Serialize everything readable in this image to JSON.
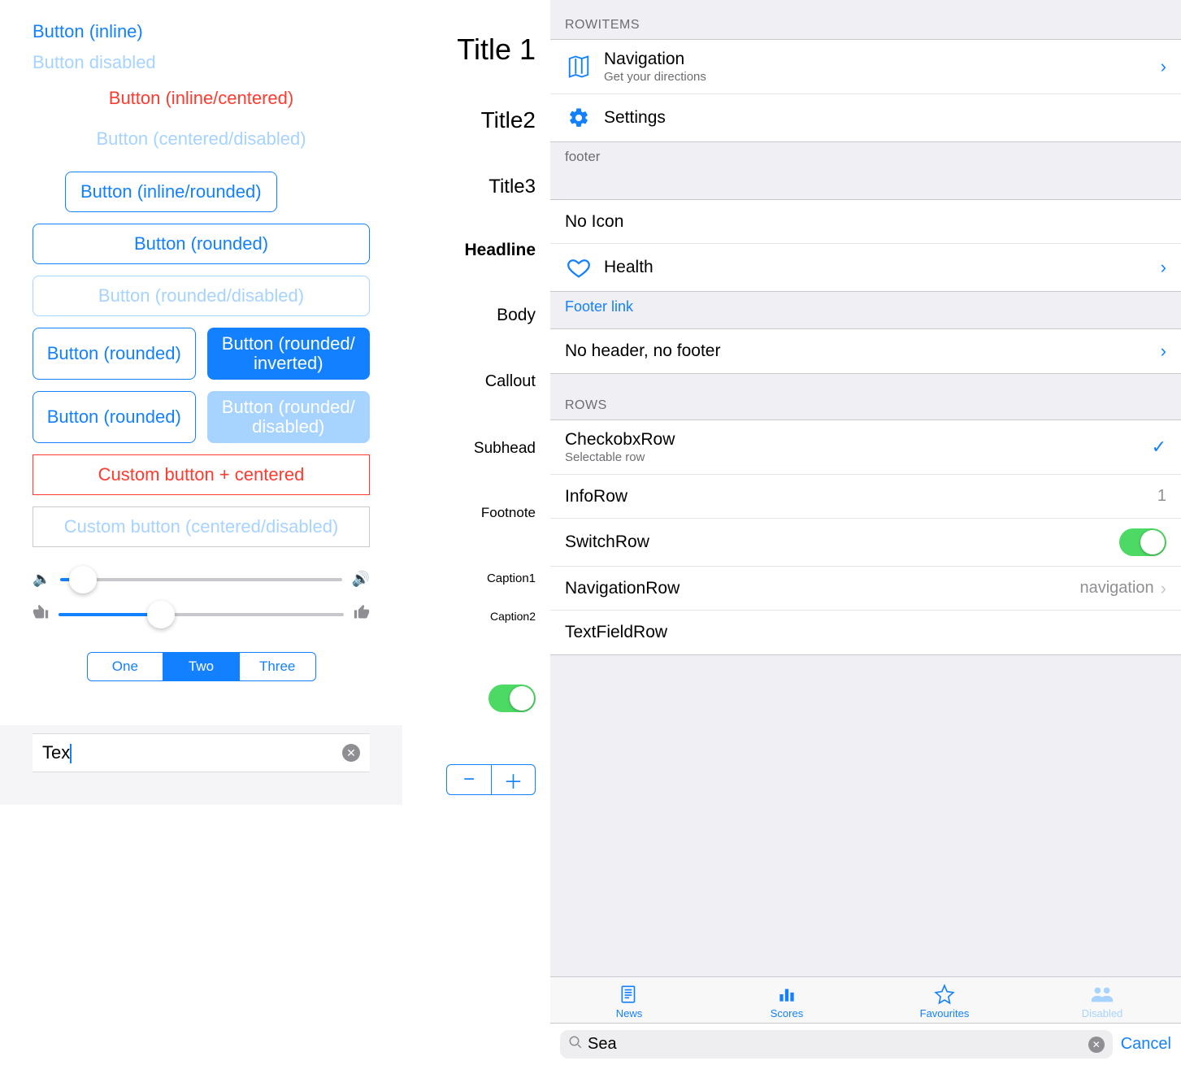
{
  "leftPanel": {
    "buttons": {
      "inline": "Button (inline)",
      "disabled": "Button disabled",
      "inlineCentered": "Button (inline/centered)",
      "centeredDisabled": "Button (centered/disabled)",
      "inlineRounded": "Button (inline/rounded)",
      "rounded": "Button (rounded)",
      "roundedDisabled": "Button (rounded/disabled)",
      "rounded2": "Button (rounded)",
      "roundedInverted": "Button (rounded/\ninverted)",
      "rounded3": "Button (rounded)",
      "roundedInvDisabled": "Button (rounded/\ndisabled)",
      "customCentered": "Custom button + centered",
      "customDisabled": "Custom button (centered/disabled)"
    },
    "sliders": {
      "volume": {
        "value": 8,
        "min": 0,
        "max": 100,
        "leftIcon": "volume-low",
        "rightIcon": "volume-high"
      },
      "like": {
        "value": 36,
        "min": 0,
        "max": 100,
        "leftIcon": "thumbs-down",
        "rightIcon": "thumbs-up"
      }
    },
    "segmented": {
      "options": [
        "One",
        "Two",
        "Three"
      ],
      "selectedIndex": 1
    },
    "textfield": {
      "value": "Tex"
    }
  },
  "typography": {
    "title1": "Title 1",
    "title2": "Title2",
    "title3": "Title3",
    "headline": "Headline",
    "body": "Body",
    "callout": "Callout",
    "subhead": "Subhead",
    "footnote": "Footnote",
    "caption1": "Caption1",
    "caption2": "Caption2"
  },
  "midControls": {
    "switchOn": true
  },
  "rightPanel": {
    "sections": {
      "rowItemsHeader": "ROWITEMS",
      "rowsHeader": "ROWS"
    },
    "rowItems": {
      "navigation": {
        "title": "Navigation",
        "subtitle": "Get your directions"
      },
      "settings": {
        "title": "Settings"
      },
      "footerText": "footer",
      "noIcon": {
        "title": "No Icon"
      },
      "health": {
        "title": "Health"
      },
      "footerLink": "Footer link",
      "noHeaderFooter": {
        "title": "No header, no footer"
      }
    },
    "rows": {
      "checkbox": {
        "title": "CheckobxRow",
        "subtitle": "Selectable row",
        "checked": true
      },
      "info": {
        "title": "InfoRow",
        "value": "1"
      },
      "switch": {
        "title": "SwitchRow",
        "on": true
      },
      "nav": {
        "title": "NavigationRow",
        "detail": "navigation"
      },
      "textfield": {
        "title": "TextFieldRow",
        "value": ""
      }
    }
  },
  "tabbar": {
    "items": [
      {
        "label": "News",
        "icon": "newspaper",
        "active": true
      },
      {
        "label": "Scores",
        "icon": "bars",
        "active": false
      },
      {
        "label": "Favourites",
        "icon": "star",
        "active": false
      },
      {
        "label": "Disabled",
        "icon": "people",
        "disabled": true
      }
    ]
  },
  "searchbar": {
    "value": "Sea",
    "cancel": "Cancel"
  }
}
